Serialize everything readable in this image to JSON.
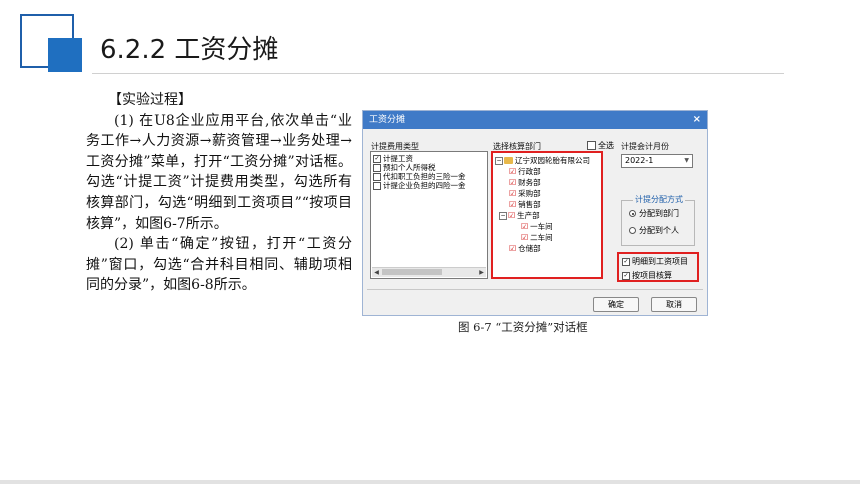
{
  "slide": {
    "title": "6.2.2  工资分摊",
    "heading": "【实验过程】",
    "para1": "(1) 在U8企业应用平台,依次单击“业务工作→人力资源→薪资管理→业务处理→工资分摊”菜单，打开“工资分摊”对话框。勾选“计提工资”计提费用类型，勾选所有核算部门，勾选“明细到工资项目”“按项目核算”，如图6-7所示。",
    "para2": "(2) 单击“确定”按钮，打开“工资分摊”窗口，勾选“合并科目相同、辅助项相同的分录”，如图6-8所示。",
    "caption": "图 6-7  “工资分摊”对话框"
  },
  "dialog": {
    "title": "工资分摊",
    "close": "×",
    "expense_type_label": "计提费用类型",
    "expense_types": [
      {
        "label": "计提工资",
        "checked": true
      },
      {
        "label": "预扣个人所得税",
        "checked": false
      },
      {
        "label": "代扣职工负担的三险一金",
        "checked": false
      },
      {
        "label": "计提企业负担的四险一金",
        "checked": false
      }
    ],
    "dept_label": "选择核算部门",
    "select_all": "全选",
    "tree": {
      "root": "辽宁双园轮胎有限公司",
      "depts": [
        "行政部",
        "财务部",
        "采购部",
        "销售部",
        "生产部",
        "仓储部"
      ],
      "sub_depts": [
        "一车间",
        "二车间"
      ]
    },
    "month_label": "计提会计月份",
    "month_value": "2022-1",
    "alloc_group_title": "计提分配方式",
    "alloc_options": [
      "分配到部门",
      "分配到个人"
    ],
    "alloc_selected": "分配到部门",
    "detail_option": "明细到工资项目",
    "project_option": "按项目核算",
    "ok": "确定",
    "cancel": "取消"
  }
}
